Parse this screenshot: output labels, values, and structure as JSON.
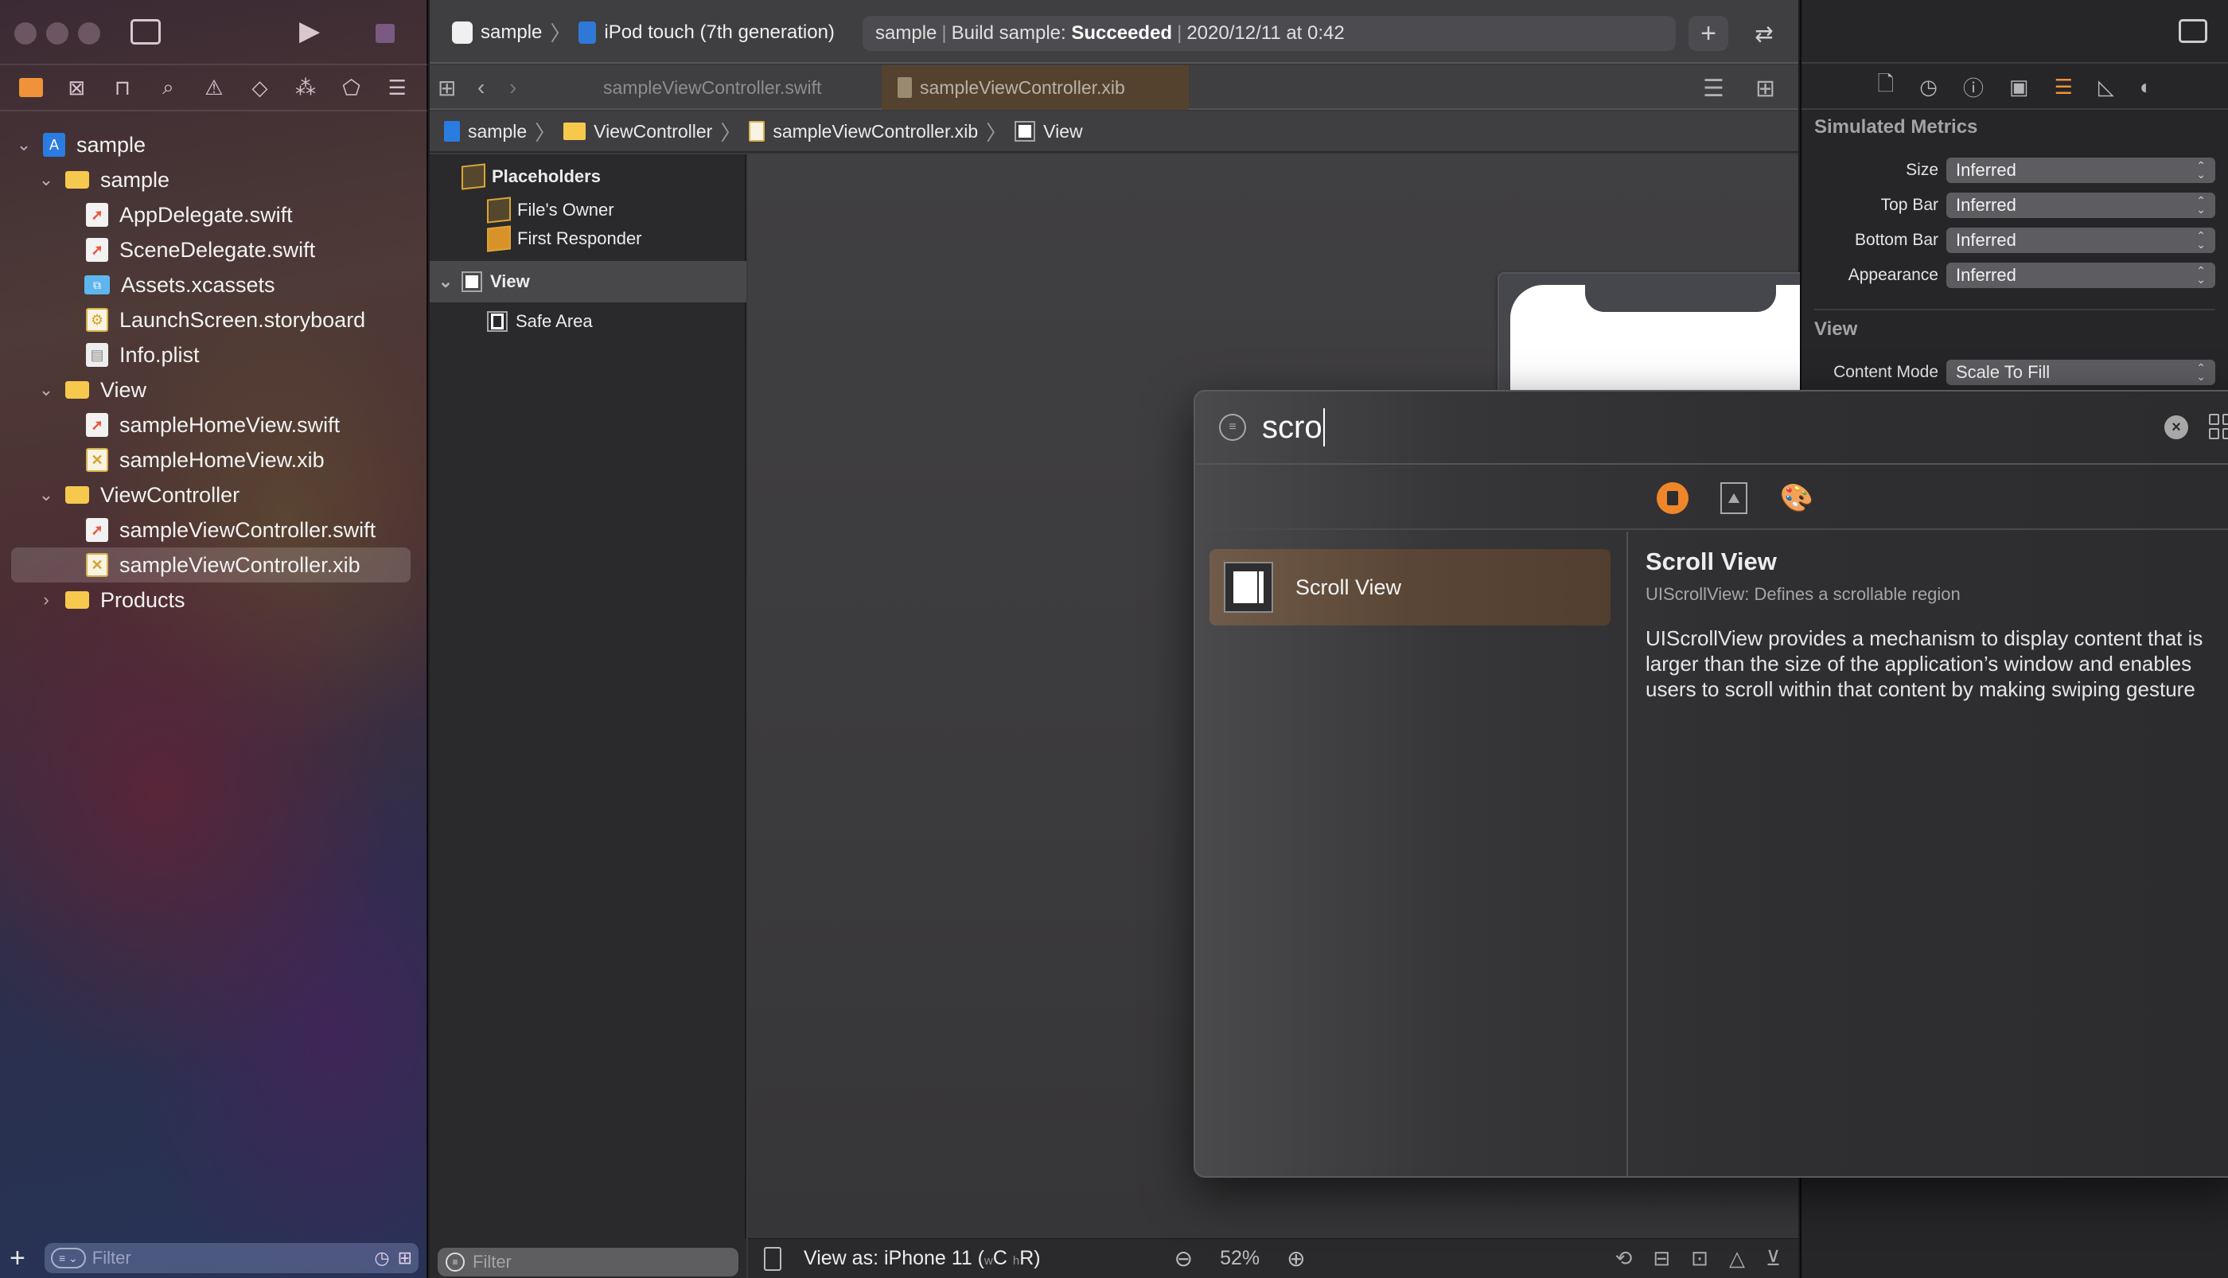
{
  "navigator": {
    "toolbar": {
      "traffic_lights": [
        "close",
        "minimize",
        "zoom"
      ],
      "sidebar_toggle_icon": "sidebar-left-icon",
      "run_icon": "play-icon",
      "stop_icon": "stop-icon"
    },
    "tabs": [
      {
        "name": "project-navigator",
        "icon": "folder-icon",
        "active": true
      },
      {
        "name": "source-control-navigator",
        "icon": "source-control-icon",
        "active": false
      },
      {
        "name": "symbol-navigator",
        "icon": "hierarchy-icon",
        "active": false
      },
      {
        "name": "find-navigator",
        "icon": "search-icon",
        "active": false
      },
      {
        "name": "issue-navigator",
        "icon": "warning-icon",
        "active": false
      },
      {
        "name": "test-navigator",
        "icon": "test-diamond-icon",
        "active": false
      },
      {
        "name": "debug-navigator",
        "icon": "spray-icon",
        "active": false
      },
      {
        "name": "breakpoint-navigator",
        "icon": "breakpoint-tag-icon",
        "active": false
      },
      {
        "name": "report-navigator",
        "icon": "report-list-icon",
        "active": false
      }
    ],
    "tree": [
      {
        "label": "sample",
        "type": "project",
        "depth": 0,
        "expanded": true
      },
      {
        "label": "sample",
        "type": "folder",
        "depth": 1,
        "expanded": true
      },
      {
        "label": "AppDelegate.swift",
        "type": "swift",
        "depth": 2
      },
      {
        "label": "SceneDelegate.swift",
        "type": "swift",
        "depth": 2
      },
      {
        "label": "Assets.xcassets",
        "type": "assets",
        "depth": 2
      },
      {
        "label": "LaunchScreen.storyboard",
        "type": "storyboard",
        "depth": 2
      },
      {
        "label": "Info.plist",
        "type": "plist",
        "depth": 2
      },
      {
        "label": "View",
        "type": "folder",
        "depth": 1,
        "expanded": true
      },
      {
        "label": "sampleHomeView.swift",
        "type": "swift",
        "depth": 2
      },
      {
        "label": "sampleHomeView.xib",
        "type": "xib",
        "depth": 2
      },
      {
        "label": "ViewController",
        "type": "folder",
        "depth": 1,
        "expanded": true
      },
      {
        "label": "sampleViewController.swift",
        "type": "swift",
        "depth": 2
      },
      {
        "label": "sampleViewController.xib",
        "type": "xib",
        "depth": 2,
        "selected": true
      },
      {
        "label": "Products",
        "type": "folder",
        "depth": 1,
        "expanded": false
      }
    ],
    "filter": {
      "placeholder": "Filter"
    }
  },
  "toolbar": {
    "scheme": "sample",
    "destination": "iPod touch (7th generation)",
    "activity": {
      "project": "sample",
      "status_prefix": "Build sample:",
      "status": "Succeeded",
      "timestamp": "2020/12/11 at 0:42"
    },
    "add_label": "+",
    "swap_label": "⇄"
  },
  "tabs": [
    {
      "label": "sampleViewController.swift",
      "active": false
    },
    {
      "label": "sampleViewController.xib",
      "active": true
    }
  ],
  "jumpbar": [
    "sample",
    "ViewController",
    "sampleViewController.xib",
    "View"
  ],
  "outline": {
    "placeholders_label": "Placeholders",
    "files_owner": "File's Owner",
    "first_responder": "First Responder",
    "view": "View",
    "safe_area": "Safe Area",
    "filter_placeholder": "Filter"
  },
  "canvas": {
    "view_as": "View as: iPhone 11 (",
    "size_class_w": "w",
    "size_class_w_value": "C",
    "size_class_h": "h",
    "size_class_h_value": "R",
    "view_as_end": ")",
    "zoom": "52%"
  },
  "inspector": {
    "sections": {
      "simulated_metrics": "Simulated Metrics",
      "view": "View"
    },
    "simulated_metrics": [
      {
        "label": "Size",
        "value": "Inferred"
      },
      {
        "label": "Top Bar",
        "value": "Inferred"
      },
      {
        "label": "Bottom Bar",
        "value": "Inferred"
      },
      {
        "label": "Appearance",
        "value": "Inferred"
      }
    ],
    "view": [
      {
        "label": "Content Mode",
        "value": "Scale To Fill"
      }
    ],
    "accent_color": "#f0923a"
  },
  "library": {
    "query": "scro",
    "results": [
      {
        "label": "Scroll View",
        "selected": true
      }
    ],
    "detail": {
      "title": "Scroll View",
      "subtitle": "UIScrollView: Defines a scrollable region",
      "description_lines": [
        "UIScrollView provides a mechanism to display content that is",
        "larger than the size of the application’s window and enables",
        "users to scroll within that content by making swiping gesture"
      ]
    },
    "accent_color": "#f0862a"
  }
}
